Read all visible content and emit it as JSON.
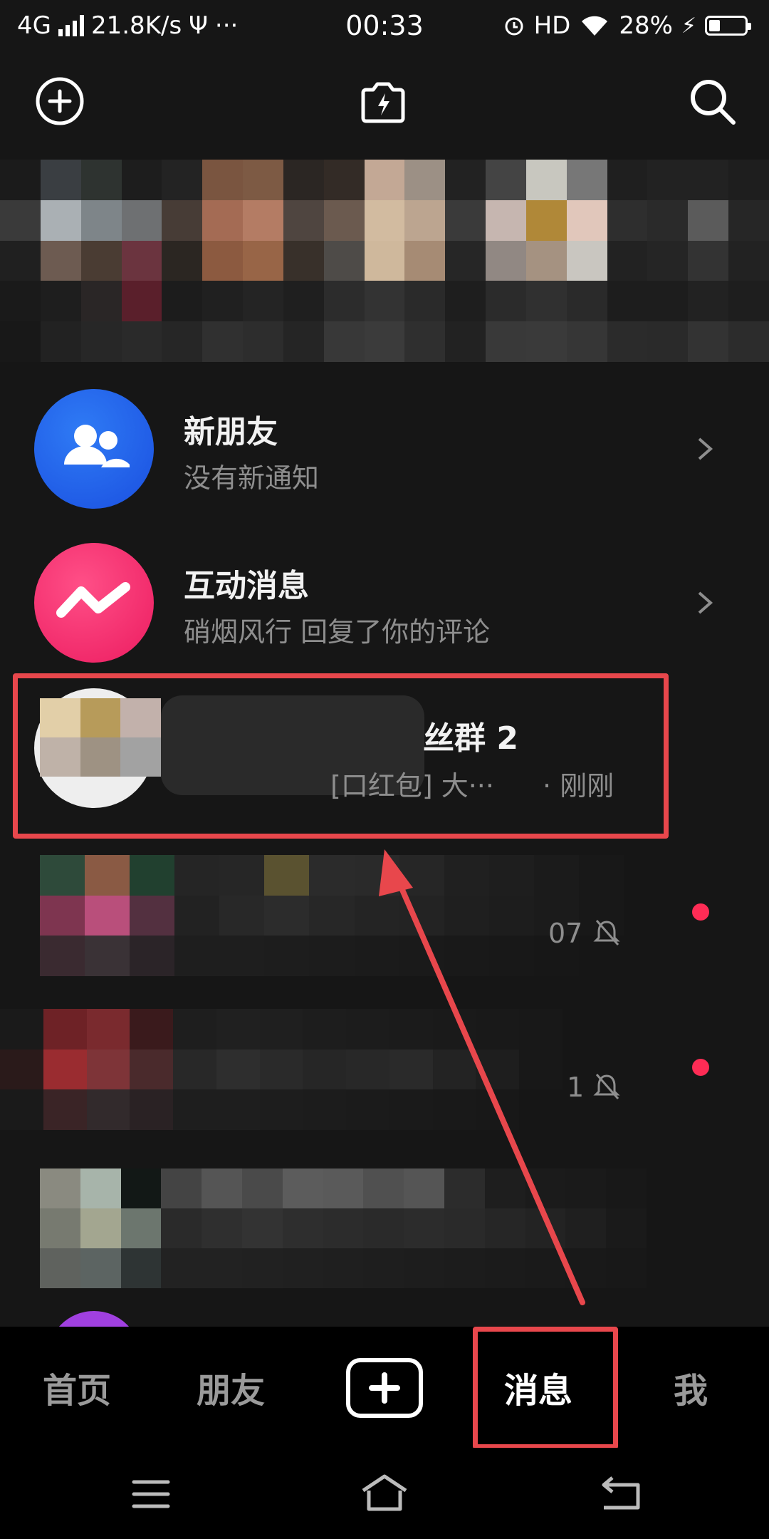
{
  "status_bar": {
    "network": "4G",
    "speed": "21.8K/s",
    "usb": "Ψ",
    "dots": "···",
    "time": "00:33",
    "hd": "HD",
    "battery_text": "28%",
    "battery_level": 0.28
  },
  "top_bar": {
    "icons": [
      "add-circle-icon",
      "camera-flash-icon",
      "search-icon"
    ]
  },
  "messages": {
    "new_friends": {
      "title": "新朋友",
      "subtitle": "没有新通知"
    },
    "interactions": {
      "title": "互动消息",
      "subtitle": "硝烟风行 回复了你的评论"
    },
    "group": {
      "title_suffix": "丝群 2",
      "preview_partial": "[口红包] 大···",
      "time": "· 刚刚"
    },
    "row4": {
      "time_partial": "07"
    },
    "row5": {
      "time_partial": "1"
    }
  },
  "bottom_nav": {
    "home": "首页",
    "friends": "朋友",
    "messages": "消息",
    "me": "我"
  },
  "colors": {
    "background": "#161616",
    "accent_red": "#fe2c55",
    "annotation_red": "#e8474c",
    "friends_blue": "#2d6df6"
  }
}
